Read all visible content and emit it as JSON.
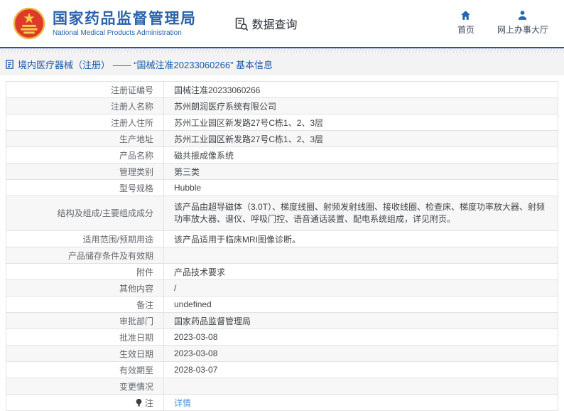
{
  "header": {
    "agency_name_cn": "国家药品监督管理局",
    "agency_name_en": "National Medical Products Administration",
    "data_query_label": "数据查询",
    "nav": [
      {
        "label": "首页",
        "icon": "home-icon"
      },
      {
        "label": "网上办事大厅",
        "icon": "user-icon"
      }
    ]
  },
  "breadcrumb": {
    "text": "境内医疗器械（注册） —— “国械注准20233060266” 基本信息",
    "icon": "document-icon"
  },
  "detail_table": {
    "rows": [
      {
        "label": "注册证编号",
        "value": "国械注准20233060266"
      },
      {
        "label": "注册人名称",
        "value": "苏州朗润医疗系统有限公司"
      },
      {
        "label": "注册人住所",
        "value": "苏州工业园区新发路27号C栋1、2、3层"
      },
      {
        "label": "生产地址",
        "value": "苏州工业园区新发路27号C栋1、2、3层"
      },
      {
        "label": "产品名称",
        "value": "磁共振成像系统"
      },
      {
        "label": "管理类别",
        "value": "第三类"
      },
      {
        "label": "型号规格",
        "value": "Hubble"
      },
      {
        "label": "结构及组成/主要组成成分",
        "value": "该产品由超导磁体（3.0T）、梯度线圈、射频发射线圈、接收线圈、检查床、梯度功率放大器、射频功率放大器、谱仪、呼吸门控、语音通话装置、配电系统组成，详见附页。"
      },
      {
        "label": "适用范围/预期用途",
        "value": "该产品适用于临床MRI图像诊断。"
      },
      {
        "label": "产品储存条件及有效期",
        "value": ""
      },
      {
        "label": "附件",
        "value": "产品技术要求"
      },
      {
        "label": "其他内容",
        "value": "/"
      },
      {
        "label": "备注",
        "value": "undefined"
      },
      {
        "label": "审批部门",
        "value": "国家药品监督管理局"
      },
      {
        "label": "批准日期",
        "value": "2023-03-08"
      },
      {
        "label": "生效日期",
        "value": "2023-03-08"
      },
      {
        "label": "有效期至",
        "value": "2028-03-07"
      },
      {
        "label": "变更情况",
        "value": ""
      },
      {
        "label": "注",
        "value": "详情",
        "value_is_link": true,
        "label_icon": "bulb-icon"
      }
    ]
  },
  "colors": {
    "brand_blue": "#2a62ab",
    "header_rule_blue": "#1d57a6",
    "breadcrumb_text_blue": "#1b5aa7",
    "link_blue": "#4a90d9",
    "breadcrumb_bg": "#f3f3f3",
    "row_alt_bg": "#f7f7f7",
    "table_border": "#e2e2e2",
    "label_text": "#62676e",
    "value_text": "#3f4449",
    "emblem_red": "#dd3a27",
    "emblem_gold": "#f5d04c"
  }
}
